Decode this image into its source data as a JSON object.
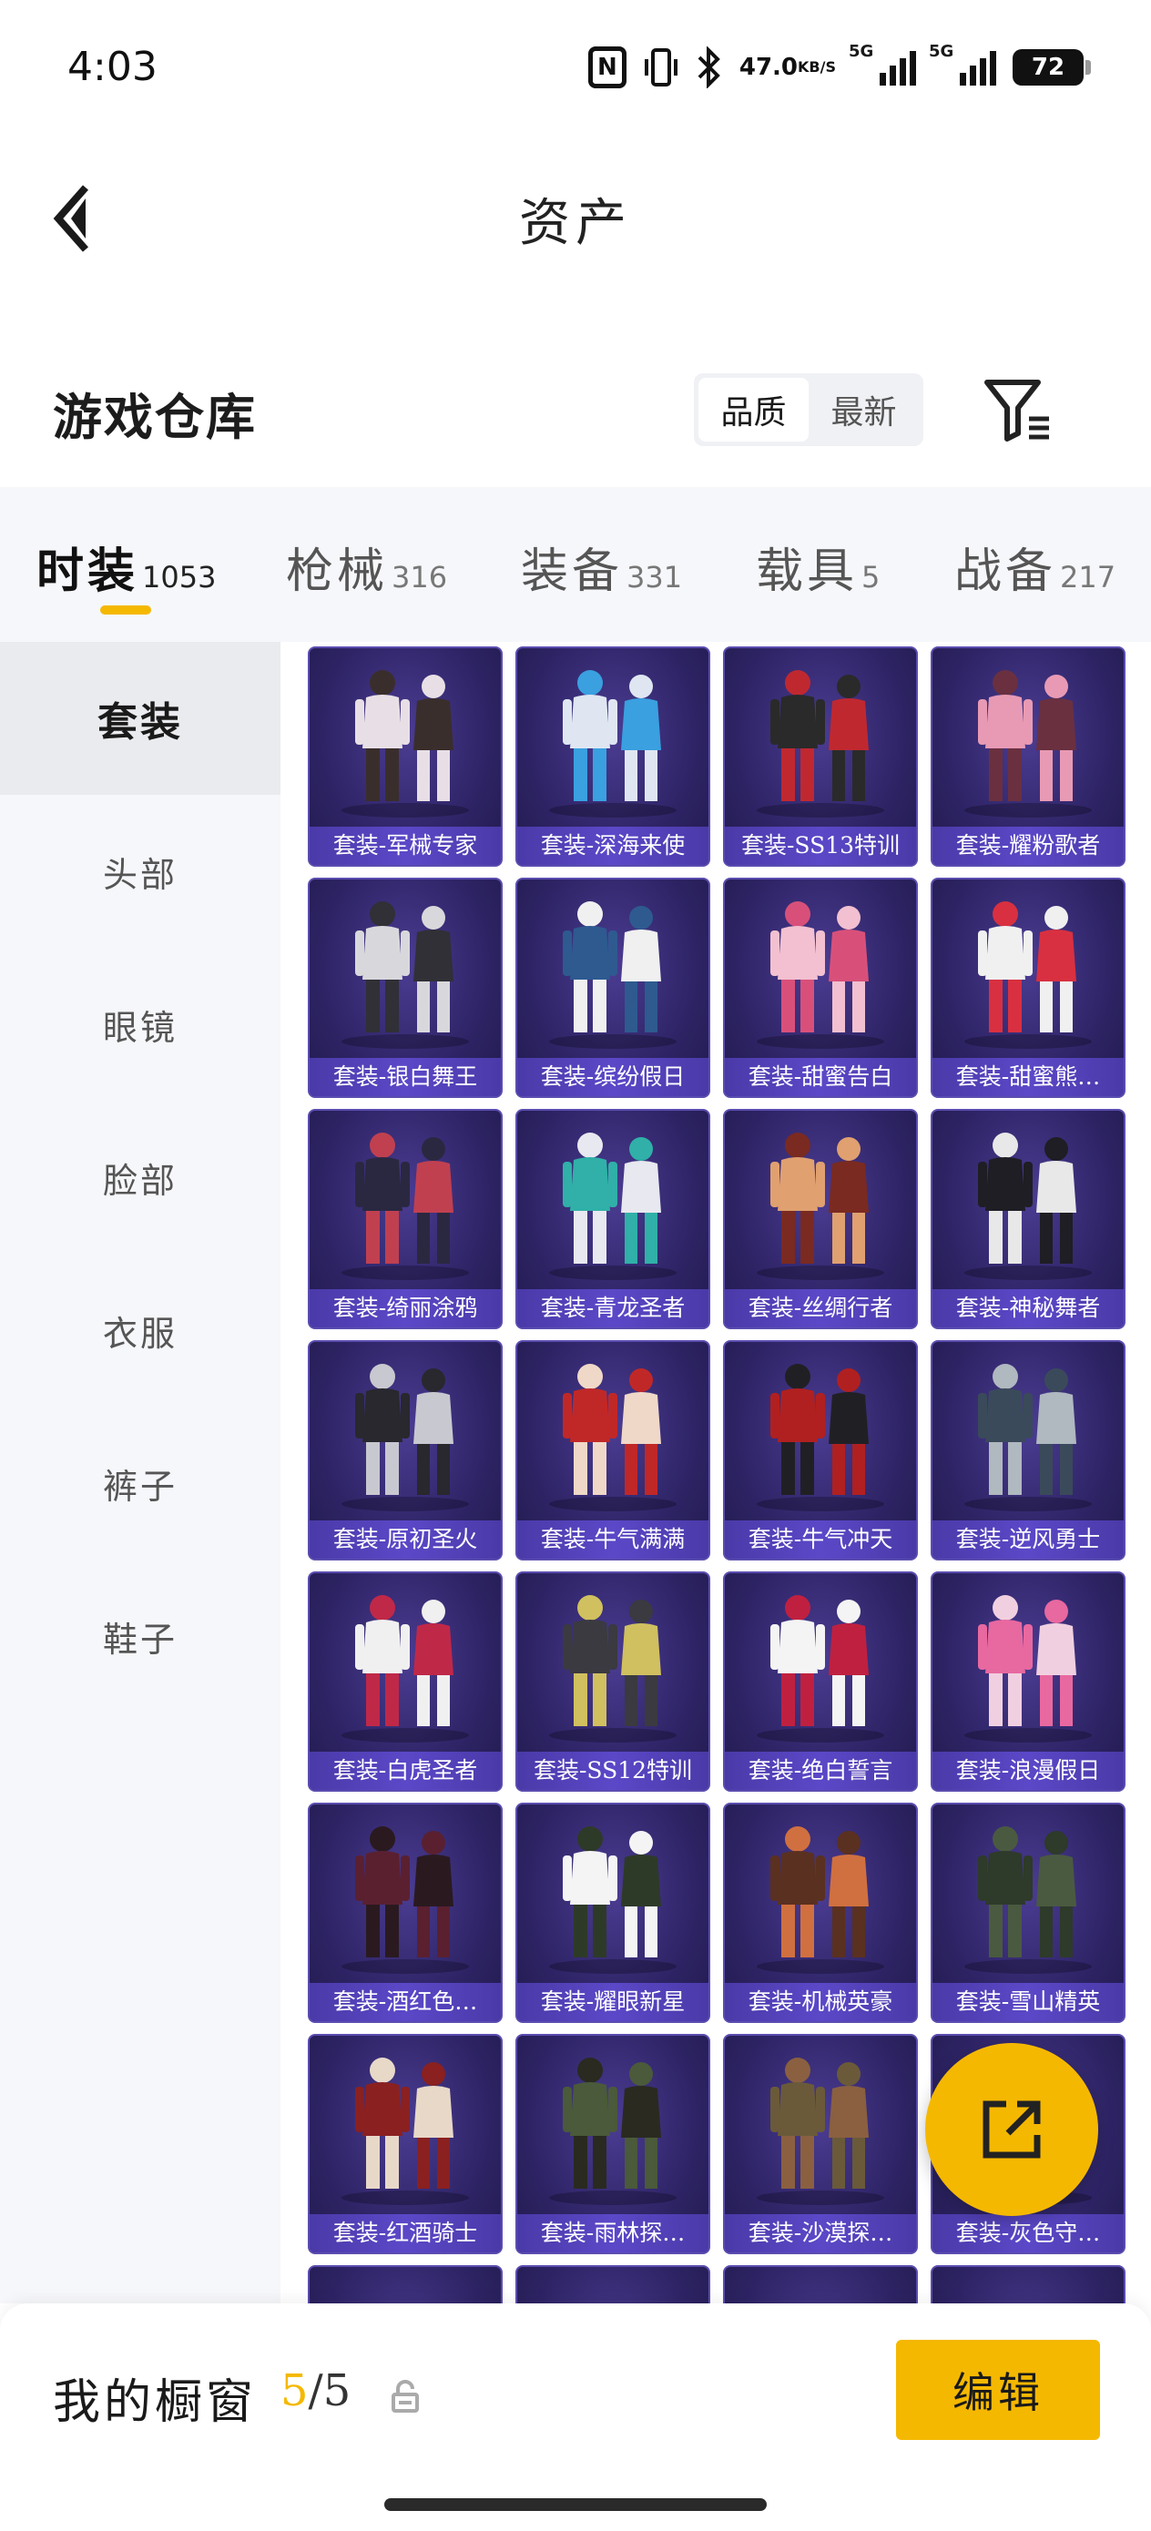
{
  "status_bar": {
    "time": "4:03",
    "nfc": "N",
    "net_speed": "47.0",
    "net_unit": "KB/S",
    "sim1": "5G",
    "sim2": "5G",
    "battery": "72",
    "icons": [
      "nfc-icon",
      "vibrate-icon",
      "bluetooth-icon",
      "signal-icon",
      "signal-icon",
      "battery-icon"
    ]
  },
  "header": {
    "title": "资产",
    "back_icon": "chevron-left-icon"
  },
  "warehouse": {
    "title": "游戏仓库",
    "sort_options": [
      "品质",
      "最新"
    ],
    "sort_active": "品质",
    "filter_icon": "filter-icon"
  },
  "categories": [
    {
      "label": "时装",
      "count": "1053",
      "active": true
    },
    {
      "label": "枪械",
      "count": "316",
      "active": false
    },
    {
      "label": "装备",
      "count": "331",
      "active": false
    },
    {
      "label": "载具",
      "count": "5",
      "active": false
    },
    {
      "label": "战备",
      "count": "217",
      "active": false
    }
  ],
  "sidebar": {
    "items": [
      "套装",
      "头部",
      "眼镜",
      "脸部",
      "衣服",
      "裤子",
      "鞋子"
    ],
    "active": "套装"
  },
  "items": [
    {
      "label": "套装-军械专家",
      "colors": [
        "#e8dfe6",
        "#3a2e2c"
      ]
    },
    {
      "label": "套装-深海来使",
      "colors": [
        "#dfe6f2",
        "#3aa0e0"
      ]
    },
    {
      "label": "套装-SS13特训",
      "colors": [
        "#2a2a2a",
        "#c02830"
      ]
    },
    {
      "label": "套装-耀粉歌者",
      "colors": [
        "#e89ab4",
        "#6a3040"
      ]
    },
    {
      "label": "套装-银白舞王",
      "colors": [
        "#d8d8dc",
        "#303036"
      ]
    },
    {
      "label": "套装-缤纷假日",
      "colors": [
        "#2e5a90",
        "#f0f0f0"
      ]
    },
    {
      "label": "套装-甜蜜告白",
      "colors": [
        "#f2c0d0",
        "#d8507a"
      ]
    },
    {
      "label": "套装-甜蜜熊…",
      "colors": [
        "#f0f0f0",
        "#d83040"
      ]
    },
    {
      "label": "套装-绮丽涂鸦",
      "colors": [
        "#2a2840",
        "#c04050"
      ]
    },
    {
      "label": "套装-青龙圣者",
      "colors": [
        "#30b0a8",
        "#e8e8f0"
      ]
    },
    {
      "label": "套装-丝绸行者",
      "colors": [
        "#e0a070",
        "#7a2a20"
      ]
    },
    {
      "label": "套装-神秘舞者",
      "colors": [
        "#1e1e24",
        "#e8e8e8"
      ]
    },
    {
      "label": "套装-原初圣火",
      "colors": [
        "#28282e",
        "#c8c8d0"
      ]
    },
    {
      "label": "套装-牛气满满",
      "colors": [
        "#c02828",
        "#f0d8c8"
      ]
    },
    {
      "label": "套装-牛气冲天",
      "colors": [
        "#b02020",
        "#202024"
      ]
    },
    {
      "label": "套装-逆风勇士",
      "colors": [
        "#3a4a5a",
        "#b0b8c0"
      ]
    },
    {
      "label": "套装-白虎圣者",
      "colors": [
        "#f0f0f0",
        "#c02848"
      ]
    },
    {
      "label": "套装-SS12特训",
      "colors": [
        "#3a3a40",
        "#d0c060"
      ]
    },
    {
      "label": "套装-绝白誓言",
      "colors": [
        "#f4f4f4",
        "#c02040"
      ]
    },
    {
      "label": "套装-浪漫假日",
      "colors": [
        "#e868a0",
        "#f0d0e0"
      ]
    },
    {
      "label": "套装-酒红色…",
      "colors": [
        "#5a2030",
        "#2a1a20"
      ]
    },
    {
      "label": "套装-耀眼新星",
      "colors": [
        "#f4f4f4",
        "#2e3a28"
      ]
    },
    {
      "label": "套装-机械英豪",
      "colors": [
        "#5a3020",
        "#d07040"
      ]
    },
    {
      "label": "套装-雪山精英",
      "colors": [
        "#2e3a2a",
        "#4a5a40"
      ]
    },
    {
      "label": "套装-红酒骑士",
      "colors": [
        "#8a2020",
        "#e8d8c8"
      ]
    },
    {
      "label": "套装-雨林探…",
      "colors": [
        "#4a5a3a",
        "#2a2a20"
      ]
    },
    {
      "label": "套装-沙漠探…",
      "colors": [
        "#6a5a3a",
        "#8a6040"
      ]
    },
    {
      "label": "套装-灰色守…",
      "colors": [
        "#6a6a70",
        "#3a3a40"
      ]
    }
  ],
  "fab_icon": "share-icon",
  "showcase": {
    "label": "我的橱窗",
    "current": "5",
    "separator": "/",
    "max": "5",
    "lock_icon": "lock-icon",
    "edit_label": "编辑"
  }
}
